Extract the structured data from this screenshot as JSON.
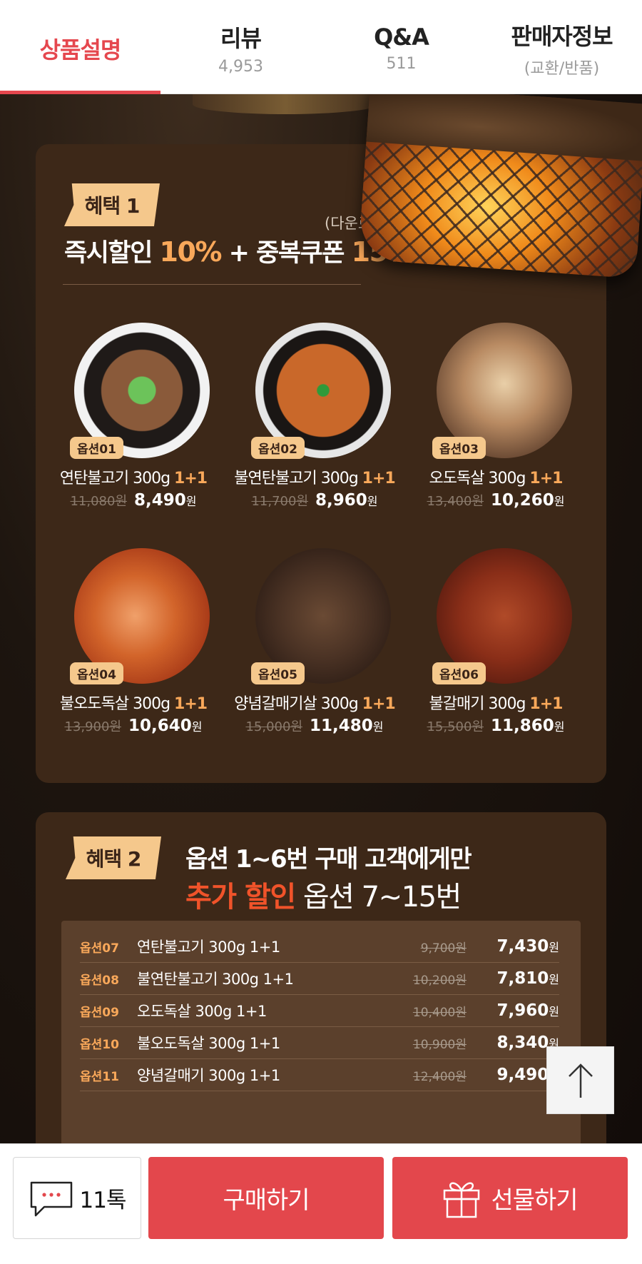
{
  "tabs": [
    {
      "label": "상품설명",
      "sub": ""
    },
    {
      "label": "리뷰",
      "sub": "4,953"
    },
    {
      "label": "Q&A",
      "sub": "511"
    },
    {
      "label": "판매자정보",
      "sub": "(교환/반품)"
    }
  ],
  "benefit1": {
    "badge": "혜택 1",
    "download": "(다운로드)",
    "headline_a": "즉시할인 ",
    "headline_b": "10%",
    "headline_c": " + 중복쿠폰 ",
    "headline_d": "15%"
  },
  "options": [
    {
      "tag": "옵션01",
      "name": "연탄불고기 300g ",
      "promo": "1+1",
      "old": "11,080원",
      "new": "8,490",
      "won": "원"
    },
    {
      "tag": "옵션02",
      "name": "불연탄불고기 300g ",
      "promo": "1+1",
      "old": "11,700원",
      "new": "8,960",
      "won": "원"
    },
    {
      "tag": "옵션03",
      "name": "오도독살 300g ",
      "promo": "1+1",
      "old": "13,400원",
      "new": "10,260",
      "won": "원"
    },
    {
      "tag": "옵션04",
      "name": "불오도독살 300g ",
      "promo": "1+1",
      "old": "13,900원",
      "new": "10,640",
      "won": "원"
    },
    {
      "tag": "옵션05",
      "name": "양념갈매기살 300g ",
      "promo": "1+1",
      "old": "15,000원",
      "new": "11,480",
      "won": "원"
    },
    {
      "tag": "옵션06",
      "name": "불갈매기 300g ",
      "promo": "1+1",
      "old": "15,500원",
      "new": "11,860",
      "won": "원"
    }
  ],
  "benefit2": {
    "badge": "혜택 2",
    "line1": "옵션 1~6번 구매 고객에게만",
    "line2_red": "추가 할인",
    "line2_rest": " 옵션 7~15번"
  },
  "extra": [
    {
      "code": "옵션07",
      "name": "연탄불고기 300g 1+1",
      "old": "9,700원",
      "new": "7,430",
      "won": "원"
    },
    {
      "code": "옵션08",
      "name": "불연탄불고기 300g 1+1",
      "old": "10,200원",
      "new": "7,810",
      "won": "원"
    },
    {
      "code": "옵션09",
      "name": "오도독살 300g 1+1",
      "old": "10,400원",
      "new": "7,960",
      "won": "원"
    },
    {
      "code": "옵션10",
      "name": "불오도독살 300g 1+1",
      "old": "10,900원",
      "new": "8,340",
      "won": "원"
    },
    {
      "code": "옵션11",
      "name": "양념갈매기 300g 1+1",
      "old": "12,400원",
      "new": "9,490",
      "won": "원"
    }
  ],
  "bottom": {
    "talk": "11톡",
    "buy": "구매하기",
    "gift": "선물하기"
  }
}
